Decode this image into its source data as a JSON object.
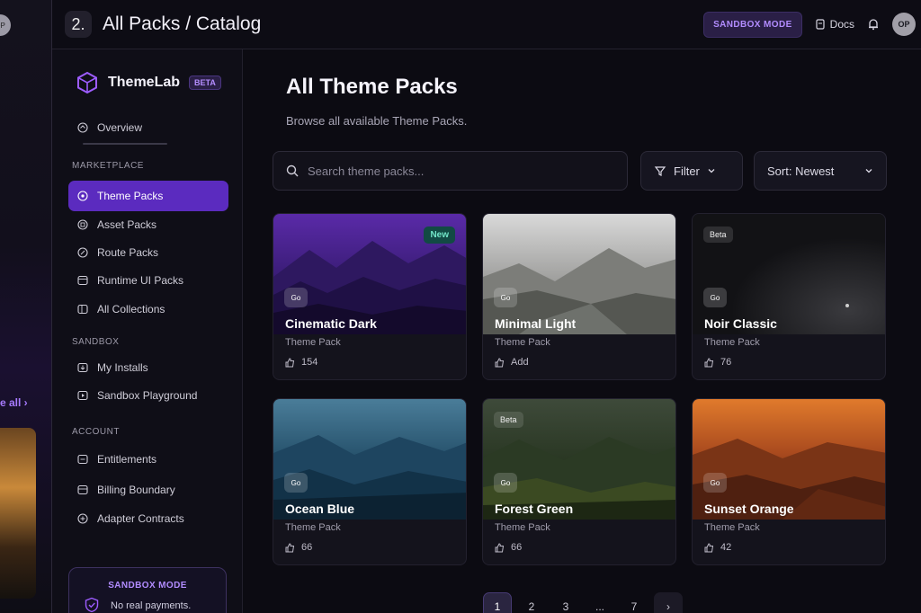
{
  "background_strip": {
    "avatar_initials": "OP",
    "see_all_label": "e all ›"
  },
  "topbar": {
    "step_number": "2.",
    "title": "All Packs / Catalog",
    "sandbox_badge": "SANDBOX MODE",
    "docs_label": "Docs",
    "avatar_initials": "OP"
  },
  "sidebar": {
    "brand": "ThemeLab",
    "beta": "BETA",
    "overview": "Overview",
    "sections": [
      {
        "label": "MARKETPLACE",
        "items": [
          "Theme Packs",
          "Asset Packs",
          "Route Packs",
          "Runtime UI Packs",
          "All Collections"
        ]
      },
      {
        "label": "SANDBOX",
        "items": [
          "My Installs",
          "Sandbox Playground"
        ]
      },
      {
        "label": "ACCOUNT",
        "items": [
          "Entitlements",
          "Billing Boundary",
          "Adapter Contracts"
        ]
      }
    ],
    "active_item": "Theme Packs",
    "sandbox_card": {
      "title": "SANDBOX MODE",
      "text": "No real payments."
    }
  },
  "main": {
    "title": "All Theme Packs",
    "subtitle": "Browse all available Theme Packs.",
    "search_placeholder": "Search theme packs...",
    "filter_label": "Filter",
    "sort_label": "Sort: Newest",
    "cards": [
      {
        "name": "Cinematic Dark",
        "type": "Theme Pack",
        "count": "154",
        "badge": "New",
        "tag": "",
        "mini": "Go"
      },
      {
        "name": "Minimal Light",
        "type": "Theme Pack",
        "count": "Add",
        "badge": "",
        "tag": "",
        "mini": "Go"
      },
      {
        "name": "Noir Classic",
        "type": "Theme Pack",
        "count": "76",
        "badge": "",
        "tag": "Beta",
        "mini": "Go"
      },
      {
        "name": "Ocean Blue",
        "type": "Theme Pack",
        "count": "66",
        "badge": "",
        "tag": "",
        "mini": "Go"
      },
      {
        "name": "Forest Green",
        "type": "Theme Pack",
        "count": "66",
        "badge": "",
        "tag": "Beta",
        "mini": "Go"
      },
      {
        "name": "Sunset Orange",
        "type": "Theme Pack",
        "count": "42",
        "badge": "",
        "tag": "",
        "mini": "Go"
      }
    ],
    "pagination": [
      "1",
      "2",
      "3",
      "...",
      "7",
      "›"
    ],
    "current_page": "1"
  },
  "colors": {
    "accent": "#5b2bbf",
    "accent_text": "#b28cff",
    "new_badge": "#72e6c9"
  }
}
